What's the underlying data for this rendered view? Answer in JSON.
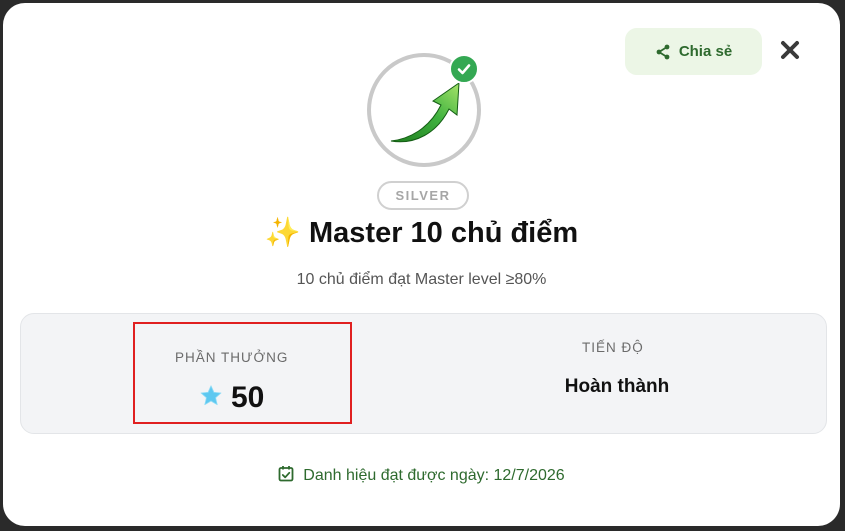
{
  "header": {
    "share_label": "Chia sẻ"
  },
  "badge": {
    "tier": "SILVER",
    "title": "✨ Master 10 chủ điểm",
    "description": "10 chủ điểm đạt Master level ≥80%",
    "icon": "green-arrow-up-icon",
    "completed_icon": "check-circle-icon"
  },
  "stats": {
    "reward_label": "PHẦN THƯỞNG",
    "reward_value": "50",
    "reward_icon": "star-icon",
    "progress_label": "TIẾN ĐỘ",
    "progress_value": "Hoàn thành"
  },
  "footer": {
    "achieved_text": "Danh hiệu đạt được ngày: 12/7/2026",
    "icon": "calendar-check-icon"
  },
  "colors": {
    "accent_green": "#2e6a2e",
    "share_bg": "#ecf6e6",
    "check_green": "#34a853",
    "highlight_red": "#e02020",
    "star_blue": "#5ec8f0"
  }
}
